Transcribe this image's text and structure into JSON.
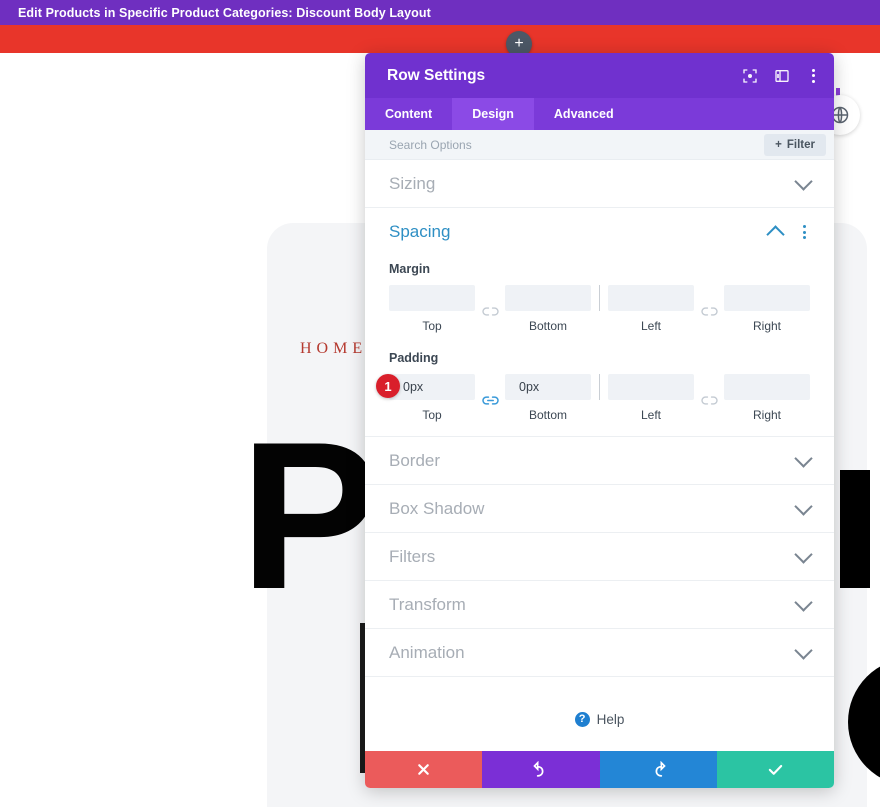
{
  "topbar": {
    "title": "Edit Products in Specific Product Categories: Discount Body Layout",
    "add_icon": "plus-icon",
    "bar_color": "#e8352a",
    "title_bg": "#6f2fc0"
  },
  "background_page": {
    "home_label": "HOME",
    "big_letter": "P",
    "globe_icon": "globe-icon"
  },
  "modal": {
    "title": "Row Settings",
    "header_icons": [
      {
        "name": "fullscreen-icon",
        "label": "Fullscreen"
      },
      {
        "name": "split-view-icon",
        "label": "Split View"
      },
      {
        "name": "more-options-icon",
        "label": "More Options"
      }
    ],
    "tabs": [
      {
        "label": "Content",
        "active": false
      },
      {
        "label": "Design",
        "active": true
      },
      {
        "label": "Advanced",
        "active": false
      }
    ],
    "search": {
      "placeholder": "Search Options",
      "value": ""
    },
    "filter_button": {
      "label": "Filter",
      "icon": "plus-icon"
    },
    "sections": [
      {
        "label": "Sizing",
        "open": false
      },
      {
        "label": "Spacing",
        "open": true
      },
      {
        "label": "Border",
        "open": false
      },
      {
        "label": "Box Shadow",
        "open": false
      },
      {
        "label": "Filters",
        "open": false
      },
      {
        "label": "Transform",
        "open": false
      },
      {
        "label": "Animation",
        "open": false
      }
    ],
    "spacing": {
      "margin": {
        "label": "Margin",
        "fields": [
          {
            "sub": "Top",
            "value": ""
          },
          {
            "sub": "Bottom",
            "value": ""
          },
          {
            "sub": "Left",
            "value": ""
          },
          {
            "sub": "Right",
            "value": ""
          }
        ],
        "link_state_vertical": "unlinked",
        "link_state_horizontal": "unlinked"
      },
      "padding": {
        "label": "Padding",
        "badge": "1",
        "badge_color": "#d91f2b",
        "fields": [
          {
            "sub": "Top",
            "value": "0px"
          },
          {
            "sub": "Bottom",
            "value": "0px"
          },
          {
            "sub": "Left",
            "value": ""
          },
          {
            "sub": "Right",
            "value": ""
          }
        ],
        "link_state_vertical": "linked",
        "link_state_horizontal": "unlinked"
      }
    },
    "help": {
      "label": "Help",
      "icon": "question-mark-icon"
    },
    "footer_buttons": [
      {
        "name": "cancel-button",
        "icon": "close-icon",
        "color": "#eb5b5b"
      },
      {
        "name": "undo-button",
        "icon": "undo-icon",
        "color": "#7b2fd6"
      },
      {
        "name": "redo-button",
        "icon": "redo-icon",
        "color": "#2386d6"
      },
      {
        "name": "save-button",
        "icon": "check-icon",
        "color": "#2bc4a3"
      }
    ]
  }
}
